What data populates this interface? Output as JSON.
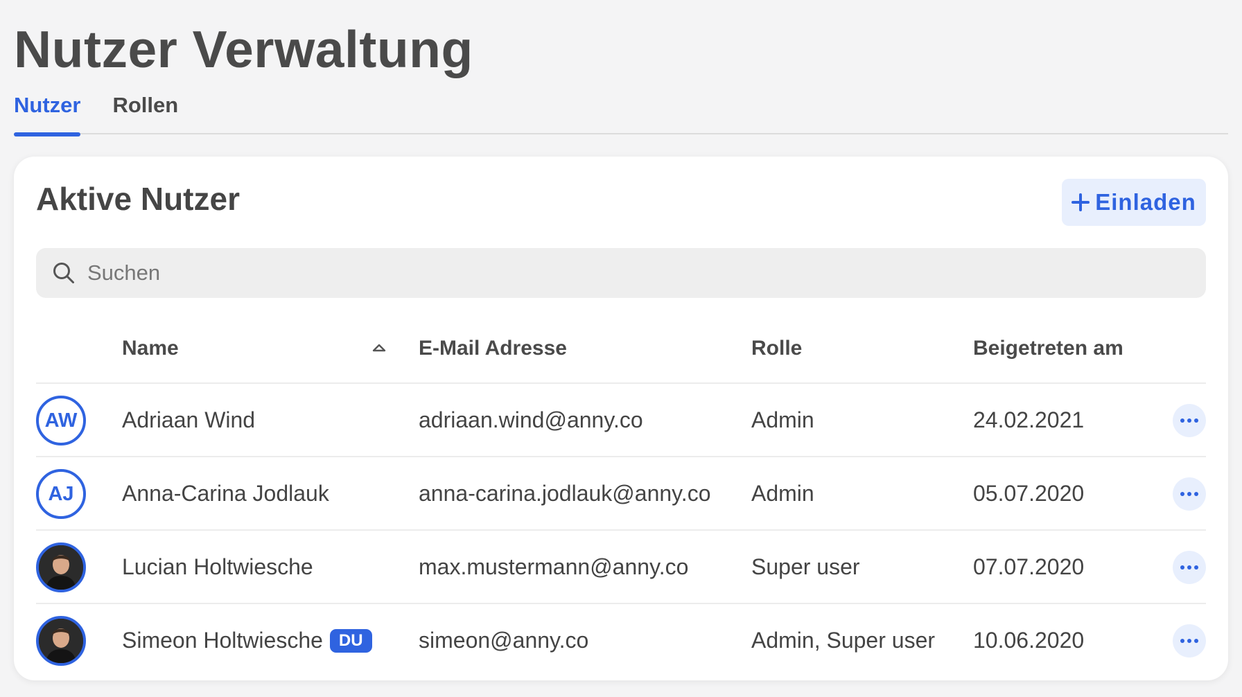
{
  "header": {
    "title": "Nutzer Verwaltung"
  },
  "tabs": [
    {
      "label": "Nutzer",
      "active": true
    },
    {
      "label": "Rollen",
      "active": false
    }
  ],
  "card": {
    "title": "Aktive Nutzer",
    "invite_label": "Einladen",
    "search": {
      "placeholder": "Suchen",
      "value": ""
    }
  },
  "table": {
    "columns": [
      "Name",
      "E-Mail Adresse",
      "Rolle",
      "Beigetreten am"
    ],
    "rows": [
      {
        "initials": "AW",
        "name": "Adriaan Wind",
        "badge": "",
        "email": "adriaan.wind@anny.co",
        "role": "Admin",
        "joined": "24.02.2021"
      },
      {
        "initials": "AJ",
        "name": "Anna-Carina Jodlauk",
        "badge": "",
        "email": "anna-carina.jodlauk@anny.co",
        "role": "Admin",
        "joined": "05.07.2020"
      },
      {
        "initials": "",
        "name": "Lucian Holtwiesche",
        "badge": "",
        "email": "max.mustermann@anny.co",
        "role": "Super user",
        "joined": "07.07.2020"
      },
      {
        "initials": "",
        "name": "Simeon Holtwiesche",
        "badge": "DU",
        "email": "simeon@anny.co",
        "role": "Admin, Super user",
        "joined": "10.06.2020"
      }
    ]
  },
  "colors": {
    "accent": "#2f63e0",
    "accent_light": "#e8effd"
  }
}
